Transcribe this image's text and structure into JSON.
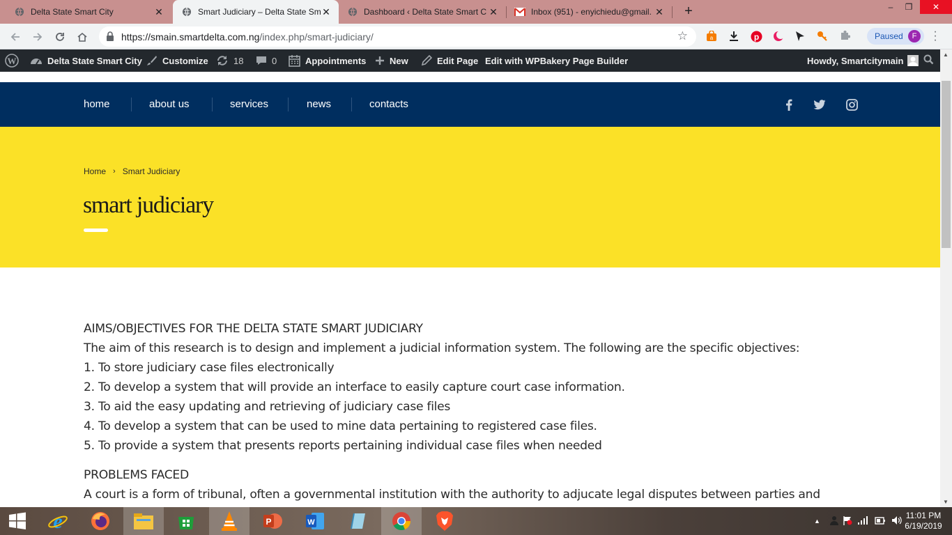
{
  "browser": {
    "tabs": [
      {
        "title": "Delta State Smart City",
        "icon": "globe-icon"
      },
      {
        "title": "Smart Judiciary – Delta State Sma",
        "icon": "globe-icon"
      },
      {
        "title": "Dashboard ‹ Delta State Smart C",
        "icon": "globe-icon"
      },
      {
        "title": "Inbox (951) - enyichiedu@gmail.",
        "icon": "gmail-icon"
      }
    ],
    "new_tab": "+",
    "window_controls": {
      "minimize": "–",
      "restore": "❐",
      "close": "✕"
    },
    "url_host": "https://smain.smartdelta.com.ng",
    "url_path": "/index.php/smart-judiciary/",
    "profile_status": "Paused",
    "profile_initial": "F"
  },
  "adminbar": {
    "site_name": "Delta State Smart City",
    "customize": "Customize",
    "updates_count": "18",
    "comments_count": "0",
    "appointments": "Appointments",
    "new": "New",
    "edit_page": "Edit Page",
    "wpbakery": "Edit with WPBakery Page Builder",
    "howdy": "Howdy, Smartcitymain"
  },
  "site": {
    "nav": [
      "home",
      "about us",
      "services",
      "news",
      "contacts"
    ],
    "social": [
      "facebook-icon",
      "twitter-icon",
      "instagram-icon"
    ],
    "breadcrumb_home": "Home",
    "breadcrumb_sep": "›",
    "breadcrumb_current": "Smart Judiciary",
    "page_title": "smart judiciary",
    "colors": {
      "nav_bg": "#002e5f",
      "hero_bg": "#fbe127"
    }
  },
  "content": {
    "heading_aims": "AIMS/OBJECTIVES FOR THE DELTA STATE SMART JUDICIARY",
    "aims_intro": "The aim of this research is to design and implement a judicial information system. The following are the specific objectives:",
    "objectives": [
      "1. To store judiciary case files electronically",
      "2. To develop a system that will provide an interface to easily capture court case information.",
      "3. To aid the easy updating and retrieving of judiciary case files",
      "4. To develop a system that can be used to mine data pertaining to registered case files.",
      "5. To provide a system that presents reports pertaining individual case files when needed"
    ],
    "heading_problems": "PROBLEMS FACED",
    "problems_text": "A court is a form of tribunal, often a governmental institution with the authority to adjucate legal disputes between parties and"
  },
  "taskbar": {
    "time": "11:01 PM",
    "date": "6/19/2019"
  }
}
